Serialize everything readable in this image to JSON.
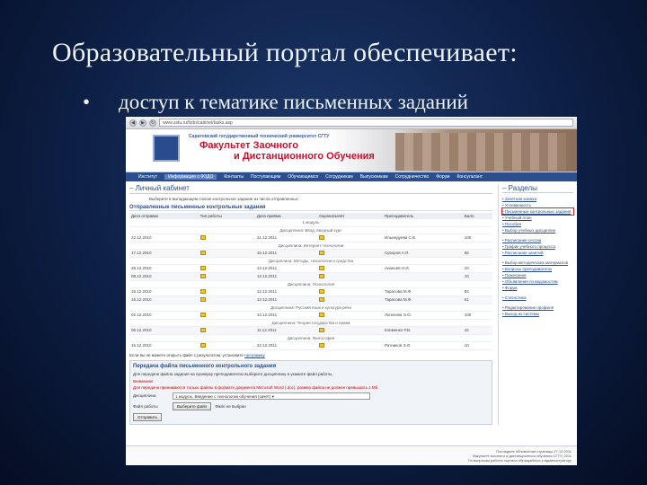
{
  "slide": {
    "title": "Образовательный портал обеспечивает:",
    "bullet_mark": "•",
    "bullet_text": "доступ к тематике письменных заданий"
  },
  "browser": {
    "url": "www.sstu.ru/fzdo/cabinet/tasks.asp"
  },
  "banner": {
    "university": "Саратовский государственный технический университет СГТУ",
    "faculty_line1": "Факультет Заочного",
    "faculty_line2": "и Дистанционного Обучения"
  },
  "menu": [
    "Институт",
    "Информация о ФЗДО",
    "Контакты",
    "Поступающим",
    "Обучающимся",
    "Сотрудникам",
    "Выпускникам",
    "Сотрудничество",
    "Форум",
    "Консультант"
  ],
  "main": {
    "section_title": "Личный кабинет",
    "info": "Выберите в выпадающем списке контрольное задание из числа отправленных",
    "table_title": "Отправленные письменные контрольные задания",
    "headers": [
      "Дата отправки",
      "Тип работы",
      "Дата приёма",
      "Оценка/зачёт",
      "Преподаватель",
      "Балл"
    ],
    "rows": [
      {
        "sub": "1 модуль"
      },
      {
        "sub": "Дисциплина: Ввод, вводный курс"
      },
      {
        "c": [
          "22.12.2010",
          "",
          "21.12.2011",
          "",
          "Ильиндуева С.В.",
          "100"
        ]
      },
      {
        "sub": "Дисциплина: Интернет-технологии"
      },
      {
        "c": [
          "17.12.2010",
          "",
          "15.12.2011",
          "",
          "Суворов А.П.",
          "65"
        ]
      },
      {
        "sub": "Дисциплина: Методы, технологии и средства"
      },
      {
        "c": [
          "28.12.2010",
          "",
          "13.12.2011",
          "",
          "Ананьев Н.И.",
          "10"
        ]
      },
      {
        "c": [
          "08.12.2010",
          "",
          "13.12.2011",
          "",
          "",
          "10"
        ]
      },
      {
        "sub": "Дисциплина: Психология"
      },
      {
        "c": [
          "15.12.2010",
          "",
          "12.12.2011",
          "",
          "Тарасова М.Ф.",
          "84"
        ]
      },
      {
        "c": [
          "16.12.2010",
          "",
          "12.12.2011",
          "",
          "Тарасова М.Ф.",
          "61"
        ]
      },
      {
        "sub": "Дисциплина: Русский язык и культура речи"
      },
      {
        "c": [
          "02.12.2010",
          "",
          "13.12.2011",
          "",
          "Логинова Э.О.",
          "100"
        ]
      },
      {
        "sub": "Дисциплина: Теория государства и права"
      },
      {
        "c": [
          "06.12.2010",
          "",
          "11.12.2011",
          "",
          "Клименко Р.В.",
          "42"
        ]
      },
      {
        "sub": "Дисциплина: Философия"
      },
      {
        "c": [
          "15.12.2010",
          "",
          "22.12.2011",
          "",
          "Ратников Э.О.",
          "10"
        ]
      }
    ],
    "note": "Если вы не можете открыть файл с результатом, установите",
    "note_link": "программу",
    "form_title": "Передача файла письменного контрольного задания",
    "form_help": "Для передачи файла задания на проверку преподавателю выберите дисциплину и укажите файл работы.",
    "warn1": "Внимание!",
    "warn2": "Для передачи принимаются только файлы в формате документа Microsoft Word (.doc), размер файла не должен превышать 1 Мб.",
    "field_discipline": "Дисциплина",
    "select_value": "1 модуль, Введение с технологии обучения (зачёт)",
    "field_file": "Файл работы",
    "browse_label": "Выберите файл",
    "no_file": "Файл не выбран",
    "send_label": "Отправить"
  },
  "sidebar": {
    "title": "Разделы",
    "items": [
      "Зачётная книжка",
      "Успеваемость",
      "Письменные контрольные задания",
      "Учебный план",
      "Пособия",
      "Выбор учебных дисциплин",
      "",
      "Расписание сессии",
      "График учебного процесса",
      "Расписание занятий",
      "",
      "Выбор методических материалов",
      "Вопросы преподавателю",
      "Пожелания",
      "Объявления по ведомостям",
      "Форум",
      "",
      "Статистика",
      "",
      "Редактирование профиля",
      "Выход из системы"
    ],
    "highlight_index": 2
  },
  "footer": {
    "line1": "Последнее обновление страницы 27.12.2011",
    "line2": "Факультет заочного и дистанционного обучения СГТУ, 2011",
    "line3": "По вопросам работы портала обращайтесь к администратору"
  }
}
